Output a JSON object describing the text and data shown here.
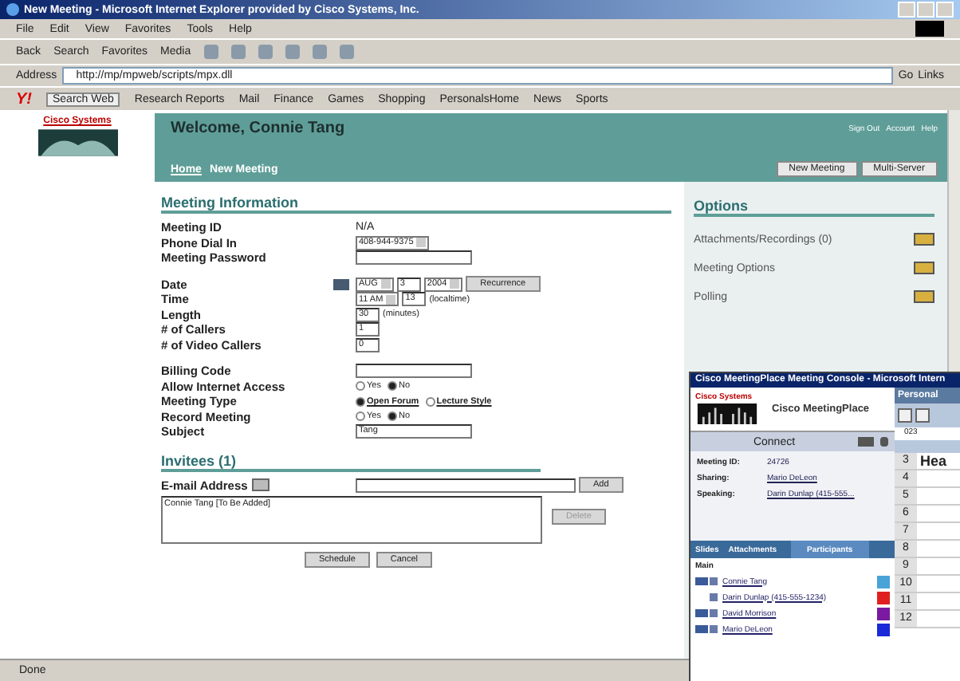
{
  "window": {
    "title": "New Meeting - Microsoft Internet Explorer provided by Cisco Systems, Inc."
  },
  "menu": [
    "File",
    "Edit",
    "View",
    "Favorites",
    "Tools",
    "Help"
  ],
  "toolbar": [
    "Back",
    "Search",
    "Favorites",
    "Media"
  ],
  "address": {
    "label": "Address",
    "value": "http://mp/mpweb/scripts/mpx.dll",
    "go": "Go",
    "links": "Links"
  },
  "links_bar": {
    "logo": "Y!",
    "search": "Search Web",
    "items": [
      "Research Reports",
      "Mail",
      "Finance",
      "Games",
      "Shopping",
      "PersonalsHome",
      "News",
      "Sports"
    ]
  },
  "header": {
    "brand": "Cisco Systems",
    "welcome": "Welcome, Connie Tang",
    "top_links": [
      "Sign Out",
      "Account",
      "Help"
    ],
    "breadcrumb": [
      {
        "label": "Home",
        "link": true
      },
      {
        "label": "New Meeting",
        "link": false
      }
    ],
    "buttons": [
      "New Meeting",
      "Multi-Server"
    ]
  },
  "meeting_info": {
    "title": "Meeting Information",
    "rows": [
      {
        "kind": "text",
        "label": "Meeting ID",
        "value": "N/A"
      },
      {
        "kind": "select",
        "label": "Phone Dial In",
        "value": "408-944-9375"
      },
      {
        "kind": "input",
        "label": "Meeting Password",
        "value": ""
      },
      {
        "kind": "gap"
      },
      {
        "kind": "date",
        "label": "Date",
        "month": "AUG",
        "day": "3",
        "year": "2004",
        "button": "Recurrence"
      },
      {
        "kind": "time",
        "label": "Time",
        "hour": "11 AM",
        "minute": "13",
        "note": "(localtime)"
      },
      {
        "kind": "small",
        "label": "Length",
        "value": "30",
        "note": "(minutes)"
      },
      {
        "kind": "small",
        "label": "# of Callers",
        "value": "1"
      },
      {
        "kind": "small",
        "label": "# of Video Callers",
        "value": "0"
      },
      {
        "kind": "gap"
      },
      {
        "kind": "input",
        "label": "Billing Code",
        "value": ""
      },
      {
        "kind": "radio",
        "label": "Allow Internet Access",
        "options": [
          {
            "label": "Yes",
            "selected": false,
            "link": false
          },
          {
            "label": "No",
            "selected": true,
            "link": false
          }
        ]
      },
      {
        "kind": "radio",
        "label": "Meeting Type",
        "options": [
          {
            "label": "Open Forum",
            "selected": true,
            "link": true
          },
          {
            "label": "Lecture Style",
            "selected": false,
            "link": true
          }
        ]
      },
      {
        "kind": "radio",
        "label": "Record Meeting",
        "options": [
          {
            "label": "Yes",
            "selected": false,
            "link": false
          },
          {
            "label": "No",
            "selected": true,
            "link": false
          }
        ]
      },
      {
        "kind": "input",
        "label": "Subject",
        "value": "Tang"
      }
    ]
  },
  "invitees": {
    "title": "Invitees (1)",
    "email_label": "E-mail Address",
    "add": "Add",
    "list": [
      "Connie Tang [To Be Added]"
    ],
    "delete": "Delete",
    "submit": "Schedule",
    "cancel": "Cancel"
  },
  "options": {
    "title": "Options",
    "items": [
      "Attachments/Recordings (0)",
      "Meeting Options",
      "Polling"
    ]
  },
  "status_bar": "Done",
  "console": {
    "title": "Cisco MeetingPlace Meeting Console - Microsoft Intern",
    "brand": "Cisco Systems",
    "product": "Cisco MeetingPlace",
    "connect": "Connect",
    "info": [
      {
        "label": "Meeting ID:",
        "value": "24726",
        "link": false
      },
      {
        "label": "Sharing:",
        "value": "Mario DeLeon",
        "link": true
      },
      {
        "label": "Speaking:",
        "value": "Darin Dunlap (415-555...",
        "link": true
      }
    ],
    "tabs": [
      {
        "label": "Slides",
        "selected": false
      },
      {
        "label": "Attachments",
        "selected": false
      },
      {
        "label": "Participants",
        "selected": true
      }
    ],
    "group": "Main",
    "participants": [
      {
        "name": "Connie Tang",
        "color": "#4aa3d8",
        "video": true
      },
      {
        "name": "Darin Dunlap (415-555-1234)",
        "color": "#e02020",
        "video": false
      },
      {
        "name": "David Morrison",
        "color": "#7a1aa0",
        "video": true
      },
      {
        "name": "Mario DeLeon",
        "color": "#1a2ad8",
        "video": true
      }
    ],
    "sheet": {
      "title": "Personal",
      "cell": "023",
      "rows": [
        "3",
        "4",
        "5",
        "6",
        "7",
        "8",
        "9",
        "10",
        "11",
        "12"
      ],
      "heading": "Hea"
    }
  }
}
